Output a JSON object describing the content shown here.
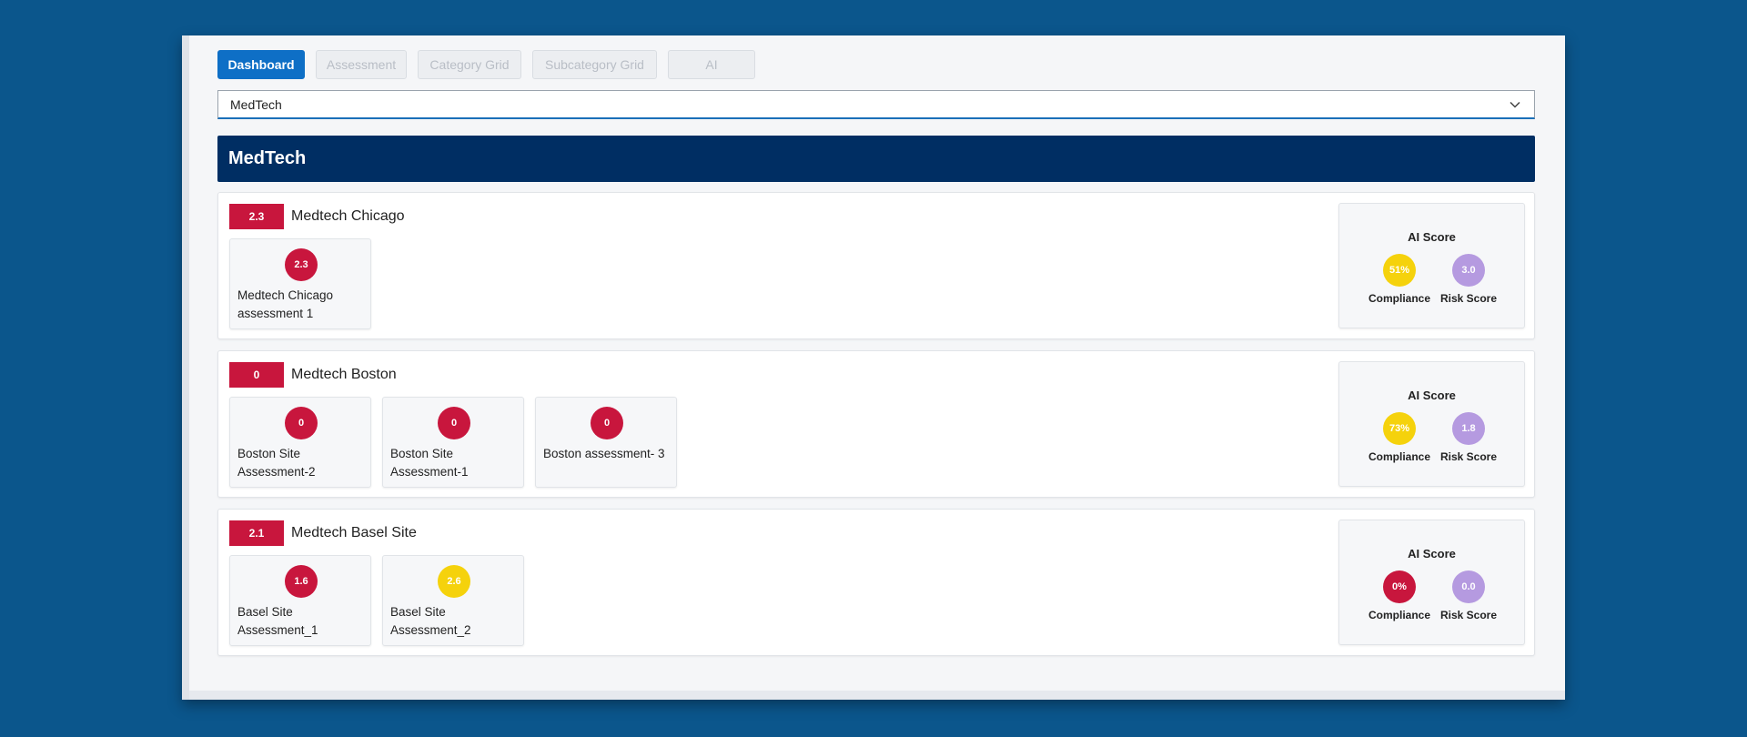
{
  "tabs": [
    {
      "label": "Dashboard",
      "active": true
    },
    {
      "label": "Assessment",
      "active": false
    },
    {
      "label": "Category Grid",
      "active": false
    },
    {
      "label": "Subcategory Grid",
      "active": false
    },
    {
      "label": "AI",
      "active": false
    }
  ],
  "selector": {
    "value": "MedTech"
  },
  "banner": {
    "title": "MedTech"
  },
  "ai_labels": {
    "title": "AI Score",
    "compliance": "Compliance",
    "risk": "Risk Score"
  },
  "colors": {
    "red": "#c8163d",
    "yellow": "#f5d20c",
    "purple": "#b59ae0",
    "navy": "#002e63",
    "accent": "#0e6fc6"
  },
  "sites": [
    {
      "score": "2.3",
      "name": "Medtech Chicago",
      "assessments": [
        {
          "score": "2.3",
          "color": "red",
          "label": "Medtech Chicago assessment 1"
        }
      ],
      "ai": {
        "compliance": "51%",
        "compliance_color": "yellow",
        "risk": "3.0"
      }
    },
    {
      "score": "0",
      "name": "Medtech Boston",
      "assessments": [
        {
          "score": "0",
          "color": "red",
          "label": "Boston Site Assessment-2"
        },
        {
          "score": "0",
          "color": "red",
          "label": "Boston Site Assessment-1"
        },
        {
          "score": "0",
          "color": "red",
          "label": "Boston assessment- 3"
        }
      ],
      "ai": {
        "compliance": "73%",
        "compliance_color": "yellow",
        "risk": "1.8"
      }
    },
    {
      "score": "2.1",
      "name": "Medtech Basel Site",
      "assessments": [
        {
          "score": "1.6",
          "color": "red",
          "label": "Basel Site Assessment_1"
        },
        {
          "score": "2.6",
          "color": "yellow",
          "label": "Basel Site Assessment_2"
        }
      ],
      "ai": {
        "compliance": "0%",
        "compliance_color": "red",
        "risk": "0.0"
      }
    }
  ]
}
